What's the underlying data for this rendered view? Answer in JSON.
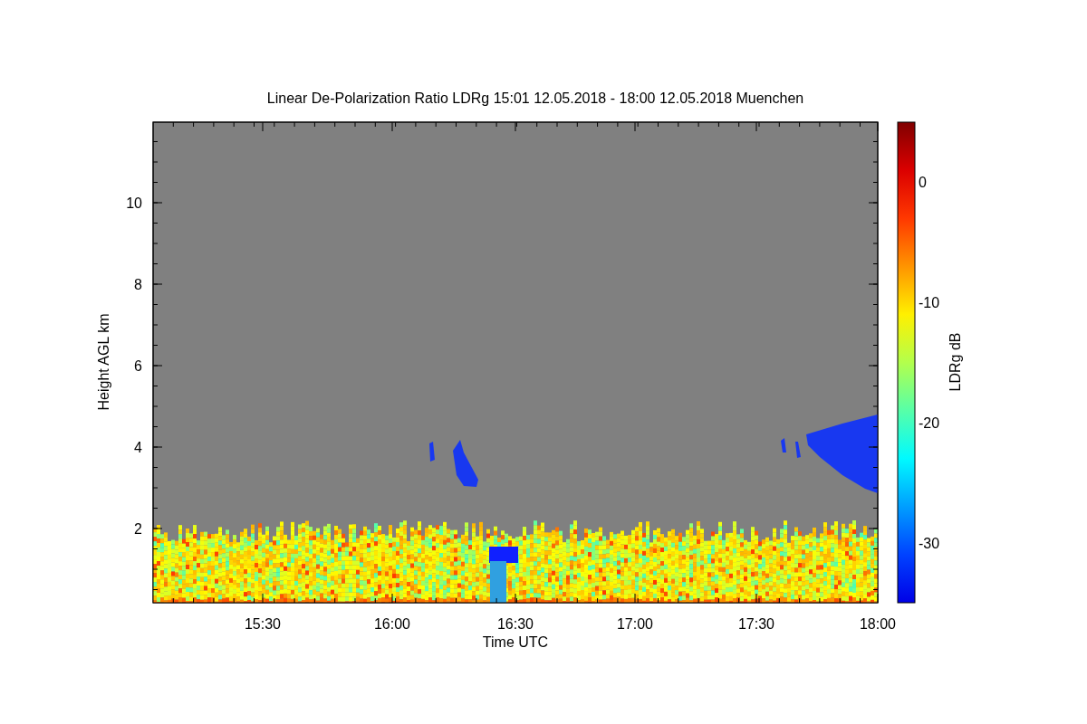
{
  "title": "Linear De-Polarization Ratio LDRg   15:01 12.05.2018 - 18:00 12.05.2018 Muenchen",
  "y_axis": {
    "label": "Height AGL km",
    "ticks": [
      "10",
      "8",
      "6",
      "4",
      "2"
    ]
  },
  "x_axis": {
    "label": "Time UTC",
    "ticks": [
      "15:30",
      "16:00",
      "16:30",
      "17:00",
      "17:30",
      "18:00"
    ]
  },
  "colorbar": {
    "label": "LDRg dB",
    "ticks": [
      "0",
      "-10",
      "-20",
      "-30"
    ]
  }
}
